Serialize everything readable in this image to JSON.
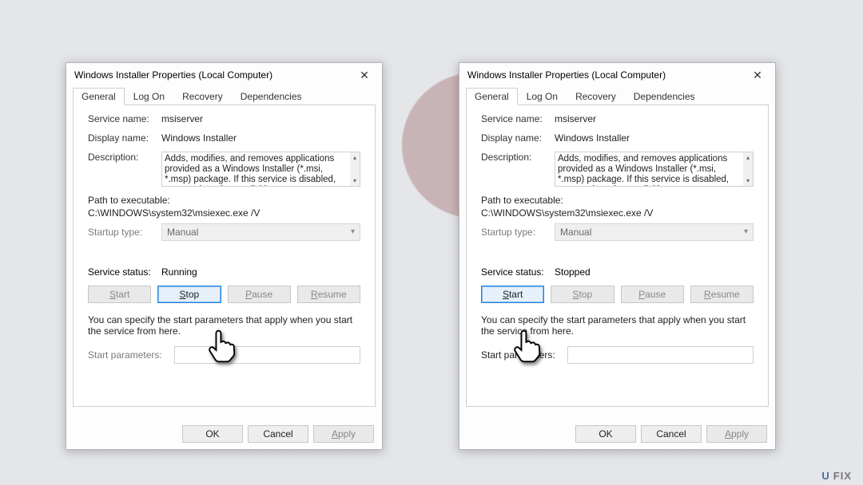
{
  "dialogs": [
    {
      "title": "Windows Installer Properties (Local Computer)",
      "tabs": [
        "General",
        "Log On",
        "Recovery",
        "Dependencies"
      ],
      "active_tab": "General",
      "service_name_label": "Service name:",
      "service_name": "msiserver",
      "display_name_label": "Display name:",
      "display_name": "Windows Installer",
      "description_label": "Description:",
      "description": "Adds, modifies, and removes applications provided as a Windows Installer (*.msi, *.msp) package. If this service is disabled, any services that explicitly",
      "path_label": "Path to executable:",
      "path": "C:\\WINDOWS\\system32\\msiexec.exe /V",
      "startup_label": "Startup type:",
      "startup_value": "Manual",
      "status_label": "Service status:",
      "status": "Running",
      "buttons": {
        "start": "Start",
        "stop": "Stop",
        "pause": "Pause",
        "resume": "Resume"
      },
      "enabled_button": "stop",
      "hint": "You can specify the start parameters that apply when you start the service from here.",
      "params_label": "Start parameters:",
      "bottom": {
        "ok": "OK",
        "cancel": "Cancel",
        "apply": "Apply"
      }
    },
    {
      "title": "Windows Installer Properties (Local Computer)",
      "tabs": [
        "General",
        "Log On",
        "Recovery",
        "Dependencies"
      ],
      "active_tab": "General",
      "service_name_label": "Service name:",
      "service_name": "msiserver",
      "display_name_label": "Display name:",
      "display_name": "Windows Installer",
      "description_label": "Description:",
      "description": "Adds, modifies, and removes applications provided as a Windows Installer (*.msi, *.msp) package. If this service is disabled, any services that explicitly",
      "path_label": "Path to executable:",
      "path": "C:\\WINDOWS\\system32\\msiexec.exe /V",
      "startup_label": "Startup type:",
      "startup_value": "Manual",
      "status_label": "Service status:",
      "status": "Stopped",
      "buttons": {
        "start": "Start",
        "stop": "Stop",
        "pause": "Pause",
        "resume": "Resume"
      },
      "enabled_button": "start",
      "hint": "You can specify the start parameters that apply when you start the service from here.",
      "params_label": "Start parameters:",
      "bottom": {
        "ok": "OK",
        "cancel": "Cancel",
        "apply": "Apply"
      }
    }
  ],
  "watermark": {
    "a": "U",
    "b": "FIX"
  }
}
